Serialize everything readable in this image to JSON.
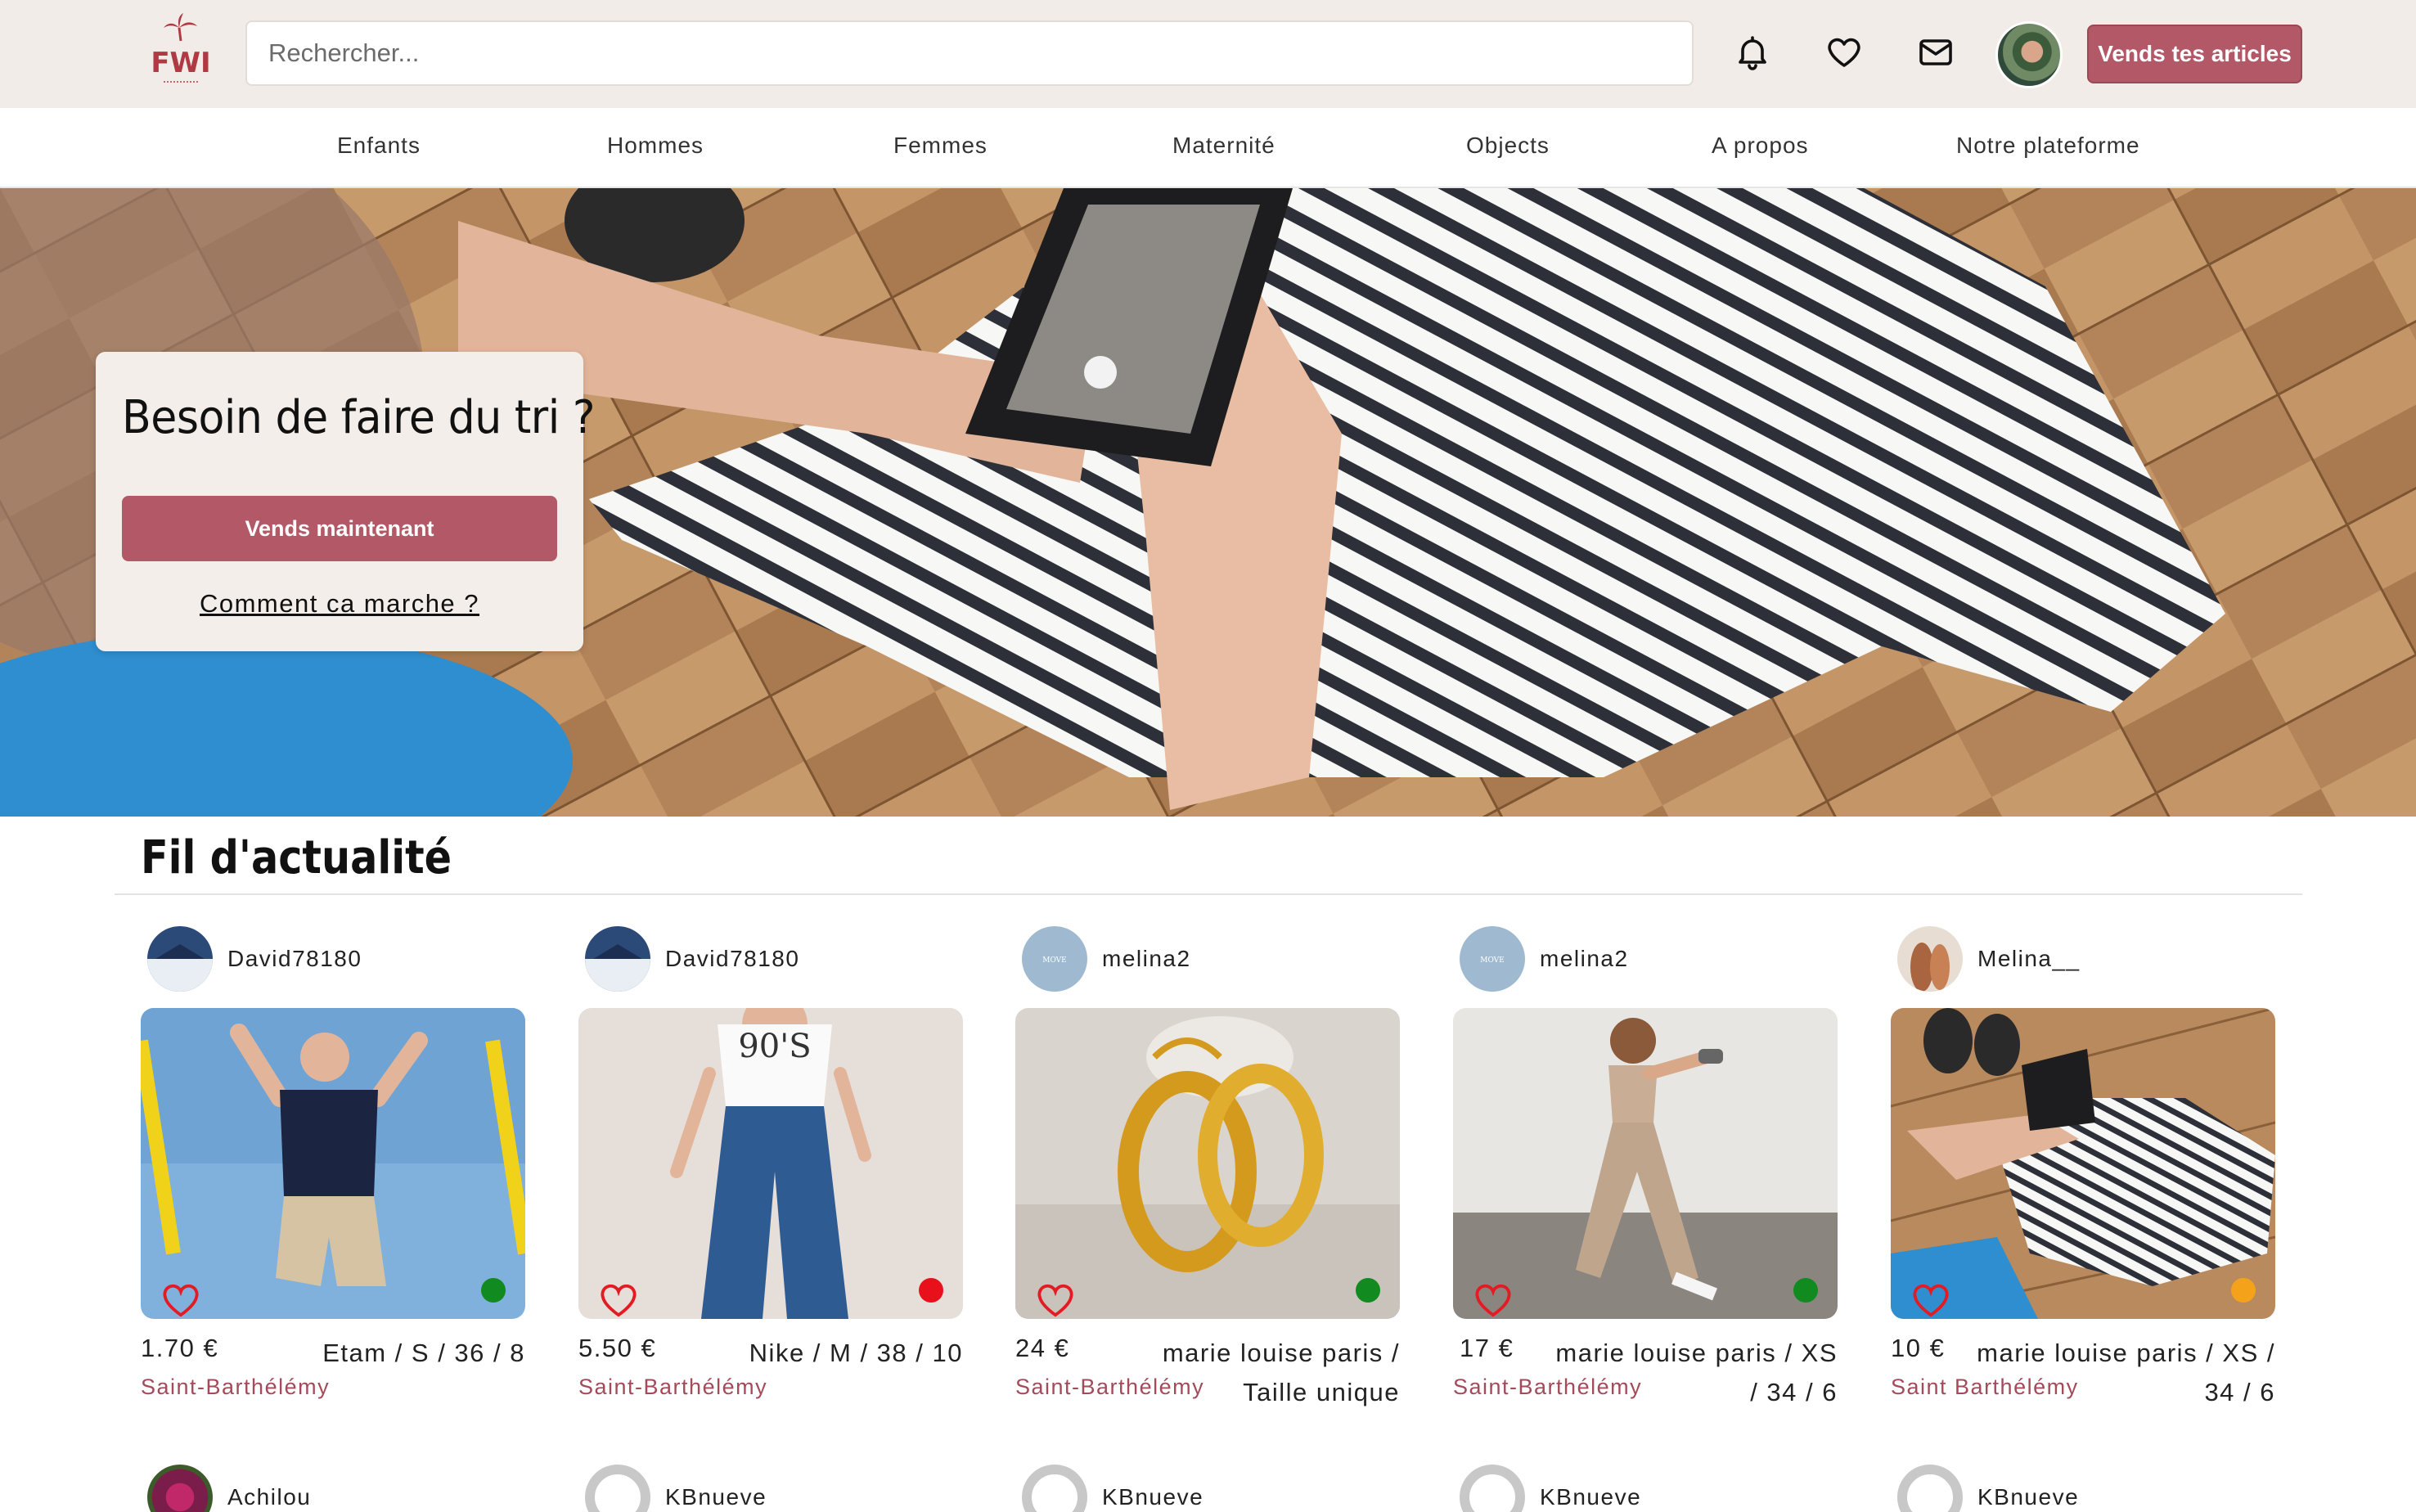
{
  "header": {
    "logo_text": "FWI",
    "search_placeholder": "Rechercher...",
    "icons": [
      "bell-icon",
      "heart-icon",
      "mail-icon"
    ],
    "sell_button": "Vends tes articles"
  },
  "nav": {
    "items": [
      "Enfants",
      "Hommes",
      "Femmes",
      "Maternité",
      "Objects",
      "A propos",
      "Notre plateforme"
    ]
  },
  "hero": {
    "title": "Besoin de faire du tri ?",
    "button": "Vends maintenant",
    "link": "Comment ca marche ?"
  },
  "feed": {
    "title": "Fil d'actualité",
    "cards": [
      {
        "user": "David78180",
        "price": "1.70 €",
        "meta": "Etam / S / 36 / 8",
        "location": "Saint-Barthélémy",
        "status_color": "#118a1f"
      },
      {
        "user": "David78180",
        "price": "5.50 €",
        "meta": "Nike / M / 38 / 10",
        "location": "Saint-Barthélémy",
        "status_color": "#e8111b"
      },
      {
        "user": "melina2",
        "price": "24 €",
        "meta_line1": "marie louise paris /",
        "meta_line2": "Taille unique",
        "location": "Saint-Barthélémy",
        "status_color": "#118a1f"
      },
      {
        "user": "melina2",
        "price": "17 €",
        "meta_line1": "marie louise paris / XS",
        "meta_line2": "/ 34 / 6",
        "location": "Saint-Barthélémy",
        "status_color": "#118a1f"
      },
      {
        "user": "Melina__",
        "price": "10 €",
        "meta_line1": "marie louise paris / XS /",
        "meta_line2": "34 / 6",
        "location": "Saint Barthélémy",
        "status_color": "#f5a21b"
      }
    ],
    "next_row_users": [
      "Achilou",
      "KBnueve",
      "KBnueve",
      "KBnueve",
      "KBnueve"
    ]
  }
}
